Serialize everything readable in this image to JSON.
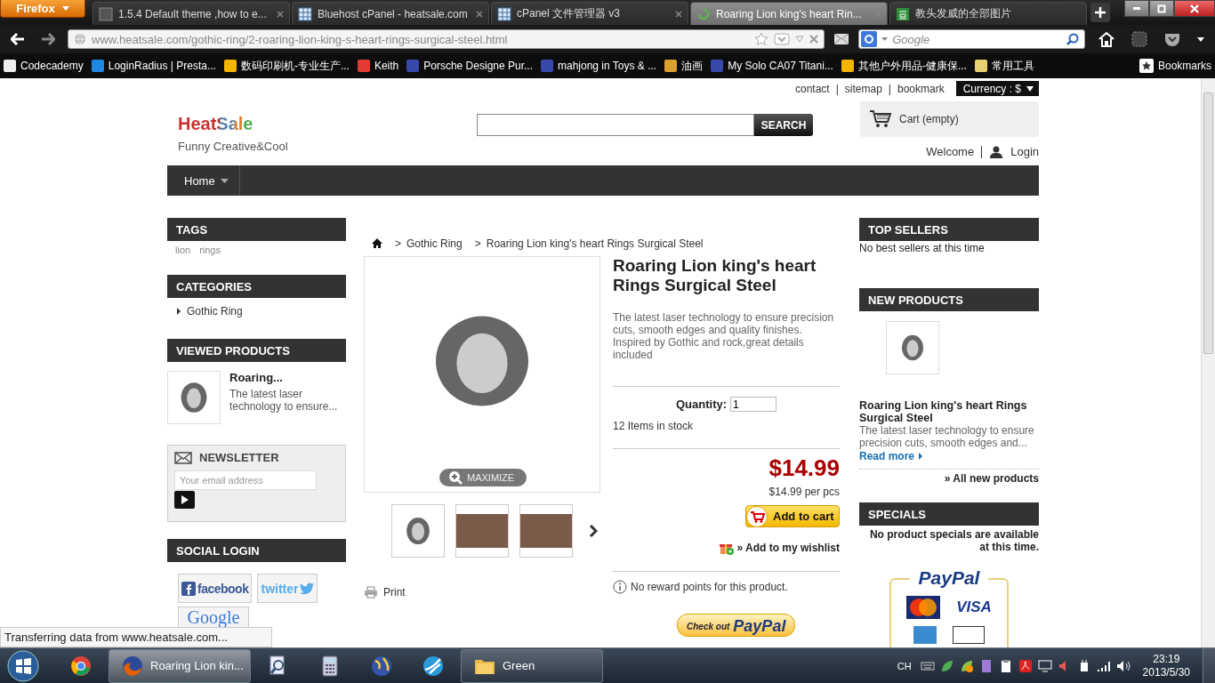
{
  "browser": {
    "app_button": "Firefox",
    "tabs": [
      {
        "title": "1.5.4 Default theme ,how to e...",
        "selected": false,
        "kind": "page"
      },
      {
        "title": "Bluehost cPanel - heatsale.com",
        "selected": false,
        "kind": "grid"
      },
      {
        "title": "cPanel 文件管理器 v3",
        "selected": false,
        "kind": "grid"
      },
      {
        "title": "Roaring Lion king's heart Rin...",
        "selected": true,
        "kind": "loading"
      },
      {
        "title": "教头发威的全部图片",
        "selected": false,
        "kind": "green"
      }
    ],
    "url": "www.heatsale.com/gothic-ring/2-roaring-lion-king-s-heart-rings-surgical-steel.html",
    "search_placeholder": "Google",
    "bookmarks": [
      "Codecademy",
      "LoginRadius | Presta...",
      "数码印刷机-专业生产...",
      "Keith",
      "Porsche Designe Pur...",
      "mahjong in Toys & ...",
      "油画",
      "My Solo CA07 Titani...",
      "其他户外用品-健康保...",
      "常用工具"
    ],
    "bookmarks_menu": "Bookmarks"
  },
  "site": {
    "top_links": [
      {
        "label": "contact"
      },
      {
        "separator": "|",
        "label": "sitemap"
      },
      {
        "separator": "|",
        "label": "bookmark"
      }
    ],
    "currency": "Currency : $",
    "logo": "HeatSale",
    "tagline": "Funny Creative&Cool",
    "search_button": "SEARCH",
    "cart": "Cart (empty)",
    "welcome": "Welcome",
    "login": "Login",
    "menu": [
      "Home"
    ],
    "left": {
      "tags": {
        "title": "TAGS",
        "items": [
          "lion",
          "rings"
        ]
      },
      "categories": {
        "title": "CATEGORIES",
        "items": [
          "Gothic Ring"
        ]
      },
      "viewed": {
        "title": "VIEWED PRODUCTS",
        "items": [
          {
            "name": "Roaring...",
            "desc": "The latest laser technology to ensure..."
          }
        ]
      },
      "newsletter": {
        "title": "NEWSLETTER",
        "placeholder": "Your email address"
      },
      "social": {
        "title": "SOCIAL LOGIN",
        "buttons": [
          {
            "kind": "facebook",
            "label": "facebook"
          },
          {
            "kind": "twitter",
            "label": "twitter"
          },
          {
            "kind": "google",
            "label": "Google"
          }
        ]
      }
    },
    "breadcrumb": [
      {
        "separator": ">",
        "label": "Gothic Ring"
      },
      {
        "separator": ">",
        "label": "Roaring Lion king's heart Rings Surgical Steel"
      }
    ],
    "product": {
      "maximize": "MAXIMIZE",
      "print": "Print",
      "title": "Roaring Lion king's heart Rings Surgical Steel",
      "description": "The latest laser technology to ensure precision cuts, smooth edges and quality finishes. Inspired by Gothic and rock,great details included",
      "quantity_label": "Quantity:",
      "quantity": "1",
      "stock": "12 Items in stock",
      "price": "$14.99",
      "unit_price": "$14.99 per pcs",
      "add_to_cart": "Add to cart",
      "wishlist": "» Add to my wishlist",
      "reward": "No reward points for this product.",
      "checkout_small": "Check out",
      "checkout_logo": "PayPal"
    },
    "right": {
      "top_sellers": {
        "title": "TOP SELLERS",
        "text": "No best sellers at this time"
      },
      "new_products": {
        "title": "NEW PRODUCTS",
        "items": [
          {
            "name": "Roaring Lion king's heart Rings Surgical Steel",
            "desc": "The latest laser technology to ensure precision cuts, smooth edges and...",
            "more": "Read more"
          }
        ],
        "all": "» All new products"
      },
      "specials": {
        "title": "SPECIALS",
        "text": "No product specials are available at this time."
      },
      "badge": {
        "logo": "PayPal",
        "card": "VISA"
      }
    }
  },
  "status_text": "Transferring data from www.heatsale.com...",
  "taskbar": {
    "items": [
      {
        "kind": "chrome",
        "selected": false
      },
      {
        "kind": "firefox",
        "label": "Roaring Lion kin...",
        "selected": true
      },
      {
        "kind": "search",
        "selected": false
      },
      {
        "kind": "calculator",
        "selected": false
      },
      {
        "kind": "globe",
        "selected": false
      },
      {
        "kind": "browser",
        "selected": false
      },
      {
        "kind": "folder",
        "label": "Green",
        "selected": false
      }
    ],
    "language": "CH",
    "time": "23:19",
    "date": "2013/5/30"
  }
}
